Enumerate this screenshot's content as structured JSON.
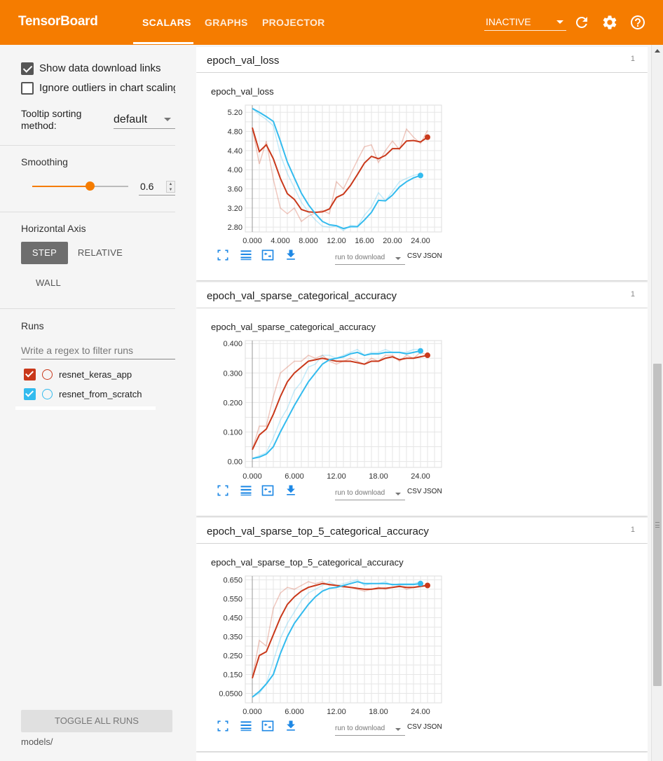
{
  "app": {
    "title": "TensorBoard"
  },
  "nav": {
    "tabs": [
      {
        "label": "SCALARS",
        "active": true
      },
      {
        "label": "GRAPHS",
        "active": false
      },
      {
        "label": "PROJECTOR",
        "active": false
      }
    ],
    "status_select": "INACTIVE",
    "icons": [
      "refresh-icon",
      "settings-gear-icon",
      "help-icon"
    ]
  },
  "sidebar": {
    "show_download_links": {
      "label": "Show data download links",
      "checked": true
    },
    "ignore_outliers": {
      "label": "Ignore outliers in chart scaling",
      "checked": false
    },
    "tooltip_sorting": {
      "label": "Tooltip sorting method:",
      "value": "default"
    },
    "smoothing": {
      "title": "Smoothing",
      "value": "0.6",
      "fraction": 0.6
    },
    "horizontal_axis": {
      "title": "Horizontal Axis",
      "options": [
        "STEP",
        "RELATIVE",
        "WALL"
      ],
      "selected": "STEP"
    },
    "runs": {
      "title": "Runs",
      "filter_placeholder": "Write a regex to filter runs",
      "items": [
        {
          "name": "resnet_keras_app",
          "color": "#c9381a",
          "checked": true
        },
        {
          "name": "resnet_from_scratch",
          "color": "#33bbee",
          "checked": true
        }
      ]
    },
    "toggle_all_label": "TOGGLE ALL RUNS",
    "logdir": "models/"
  },
  "cards": [
    {
      "group": "epoch_val_loss",
      "count": "1",
      "title": "epoch_val_loss",
      "download_placeholder": "run to download",
      "csv": "CSV",
      "json": "JSON"
    },
    {
      "group": "epoch_val_sparse_categorical_accuracy",
      "count": "1",
      "title": "epoch_val_sparse_categorical_accuracy",
      "download_placeholder": "run to download",
      "csv": "CSV",
      "json": "JSON"
    },
    {
      "group": "epoch_val_sparse_top_5_categorical_accuracy",
      "count": "1",
      "title": "epoch_val_sparse_top_5_categorical_accuracy",
      "download_placeholder": "run to download",
      "csv": "CSV",
      "json": "JSON"
    }
  ],
  "chart_data": [
    {
      "type": "line",
      "title": "epoch_val_loss",
      "xlabel": "",
      "ylabel": "",
      "xlim": [
        -1,
        27
      ],
      "ylim": [
        2.7,
        5.35
      ],
      "xticks": [
        0,
        4,
        8,
        12,
        16,
        20,
        24
      ],
      "xtick_labels": [
        "0.000",
        "4.000",
        "8.000",
        "12.00",
        "16.00",
        "20.00",
        "24.00"
      ],
      "yticks": [
        2.8,
        3.2,
        3.6,
        4.0,
        4.4,
        4.8,
        5.2
      ],
      "ytick_labels": [
        "2.80",
        "3.20",
        "3.60",
        "4.00",
        "4.40",
        "4.80",
        "5.20"
      ],
      "grid": true,
      "series": [
        {
          "name": "resnet_keras_app",
          "color": "#c9381a",
          "x": [
            0,
            1,
            2,
            3,
            4,
            5,
            6,
            7,
            8,
            9,
            10,
            11,
            12,
            13,
            14,
            15,
            16,
            17,
            18,
            19,
            20,
            21,
            22,
            23,
            24,
            25
          ],
          "raw": [
            4.88,
            4.12,
            4.6,
            3.8,
            3.2,
            3.08,
            3.2,
            2.92,
            3.03,
            3.1,
            3.15,
            3.08,
            3.75,
            3.6,
            3.9,
            4.2,
            4.48,
            4.52,
            4.15,
            4.4,
            4.6,
            4.42,
            4.85,
            4.68,
            4.55,
            4.82
          ],
          "smoothed": [
            4.88,
            4.38,
            4.52,
            4.23,
            3.82,
            3.5,
            3.38,
            3.17,
            3.12,
            3.11,
            3.12,
            3.18,
            3.42,
            3.49,
            3.67,
            3.9,
            4.14,
            4.28,
            4.23,
            4.3,
            4.44,
            4.44,
            4.6,
            4.61,
            4.58,
            4.68
          ]
        },
        {
          "name": "resnet_from_scratch",
          "color": "#33bbee",
          "x": [
            0,
            1,
            2,
            3,
            4,
            5,
            6,
            7,
            8,
            9,
            10,
            11,
            12,
            13,
            14,
            15,
            16,
            17,
            18,
            19,
            20,
            21,
            22,
            23,
            24
          ],
          "raw": [
            5.28,
            5.15,
            5.05,
            4.92,
            4.32,
            3.92,
            3.62,
            3.32,
            3.12,
            2.95,
            2.82,
            2.8,
            2.82,
            2.73,
            2.84,
            2.82,
            3.05,
            3.22,
            3.52,
            3.35,
            3.55,
            3.75,
            3.82,
            3.88,
            3.92
          ],
          "smoothed": [
            5.28,
            5.2,
            5.11,
            5.01,
            4.6,
            4.16,
            3.83,
            3.51,
            3.27,
            3.08,
            2.92,
            2.85,
            2.83,
            2.77,
            2.81,
            2.81,
            2.95,
            3.11,
            3.36,
            3.35,
            3.47,
            3.64,
            3.75,
            3.83,
            3.88
          ]
        }
      ]
    },
    {
      "type": "line",
      "title": "epoch_val_sparse_categorical_accuracy",
      "xlabel": "",
      "ylabel": "",
      "xlim": [
        -1,
        27
      ],
      "ylim": [
        -0.02,
        0.41
      ],
      "xticks": [
        0,
        6,
        12,
        18,
        24
      ],
      "xtick_labels": [
        "0.000",
        "6.000",
        "12.00",
        "18.00",
        "24.00"
      ],
      "yticks": [
        0,
        0.1,
        0.2,
        0.3,
        0.4
      ],
      "ytick_labels": [
        "0.00",
        "0.100",
        "0.200",
        "0.300",
        "0.400"
      ],
      "grid": true,
      "series": [
        {
          "name": "resnet_keras_app",
          "color": "#c9381a",
          "x": [
            0,
            1,
            2,
            3,
            4,
            5,
            6,
            7,
            8,
            9,
            10,
            11,
            12,
            13,
            14,
            15,
            16,
            17,
            18,
            19,
            20,
            21,
            22,
            23,
            24,
            25
          ],
          "raw": [
            0.04,
            0.12,
            0.12,
            0.22,
            0.3,
            0.32,
            0.34,
            0.34,
            0.36,
            0.35,
            0.36,
            0.34,
            0.33,
            0.34,
            0.35,
            0.34,
            0.33,
            0.35,
            0.34,
            0.36,
            0.36,
            0.34,
            0.36,
            0.35,
            0.37,
            0.36
          ],
          "smoothed": [
            0.04,
            0.09,
            0.11,
            0.16,
            0.22,
            0.27,
            0.3,
            0.32,
            0.34,
            0.345,
            0.35,
            0.345,
            0.34,
            0.34,
            0.34,
            0.335,
            0.33,
            0.34,
            0.34,
            0.35,
            0.355,
            0.345,
            0.35,
            0.35,
            0.355,
            0.36
          ]
        },
        {
          "name": "resnet_from_scratch",
          "color": "#33bbee",
          "x": [
            0,
            1,
            2,
            3,
            4,
            5,
            6,
            7,
            8,
            9,
            10,
            11,
            12,
            13,
            14,
            15,
            16,
            17,
            18,
            19,
            20,
            21,
            22,
            23,
            24
          ],
          "raw": [
            0.01,
            0.02,
            0.03,
            0.08,
            0.14,
            0.18,
            0.24,
            0.27,
            0.32,
            0.33,
            0.36,
            0.36,
            0.35,
            0.36,
            0.37,
            0.38,
            0.36,
            0.37,
            0.37,
            0.38,
            0.37,
            0.37,
            0.37,
            0.38,
            0.38
          ],
          "smoothed": [
            0.01,
            0.015,
            0.025,
            0.05,
            0.1,
            0.145,
            0.19,
            0.23,
            0.27,
            0.3,
            0.33,
            0.345,
            0.35,
            0.355,
            0.365,
            0.37,
            0.36,
            0.365,
            0.365,
            0.37,
            0.37,
            0.37,
            0.365,
            0.37,
            0.375
          ]
        }
      ]
    },
    {
      "type": "line",
      "title": "epoch_val_sparse_top_5_categorical_accuracy",
      "xlabel": "",
      "ylabel": "",
      "xlim": [
        -1,
        27
      ],
      "ylim": [
        0.0,
        0.67
      ],
      "xticks": [
        0,
        6,
        12,
        18,
        24
      ],
      "xtick_labels": [
        "0.000",
        "6.000",
        "12.00",
        "18.00",
        "24.00"
      ],
      "yticks": [
        0.05,
        0.15,
        0.25,
        0.35,
        0.45,
        0.55,
        0.65
      ],
      "ytick_labels": [
        "0.0500",
        "0.150",
        "0.250",
        "0.350",
        "0.450",
        "0.550",
        "0.650"
      ],
      "grid": true,
      "series": [
        {
          "name": "resnet_keras_app",
          "color": "#c9381a",
          "x": [
            0,
            1,
            2,
            3,
            4,
            5,
            6,
            7,
            8,
            9,
            10,
            11,
            12,
            13,
            14,
            15,
            16,
            17,
            18,
            19,
            20,
            21,
            22,
            23,
            24,
            25
          ],
          "raw": [
            0.13,
            0.33,
            0.3,
            0.5,
            0.58,
            0.61,
            0.6,
            0.62,
            0.64,
            0.63,
            0.64,
            0.62,
            0.62,
            0.61,
            0.61,
            0.6,
            0.59,
            0.6,
            0.61,
            0.6,
            0.61,
            0.62,
            0.6,
            0.61,
            0.62,
            0.62
          ],
          "smoothed": [
            0.13,
            0.25,
            0.27,
            0.36,
            0.45,
            0.52,
            0.56,
            0.59,
            0.61,
            0.62,
            0.63,
            0.625,
            0.62,
            0.615,
            0.61,
            0.605,
            0.6,
            0.6,
            0.605,
            0.605,
            0.61,
            0.615,
            0.61,
            0.61,
            0.615,
            0.62
          ]
        },
        {
          "name": "resnet_from_scratch",
          "color": "#33bbee",
          "x": [
            0,
            1,
            2,
            3,
            4,
            5,
            6,
            7,
            8,
            9,
            10,
            11,
            12,
            13,
            14,
            15,
            16,
            17,
            18,
            19,
            20,
            21,
            22,
            23,
            24
          ],
          "raw": [
            0.03,
            0.05,
            0.1,
            0.22,
            0.34,
            0.42,
            0.48,
            0.54,
            0.58,
            0.6,
            0.62,
            0.64,
            0.62,
            0.63,
            0.64,
            0.65,
            0.62,
            0.63,
            0.63,
            0.64,
            0.62,
            0.63,
            0.63,
            0.63,
            0.64
          ],
          "smoothed": [
            0.03,
            0.06,
            0.1,
            0.15,
            0.26,
            0.35,
            0.42,
            0.47,
            0.52,
            0.56,
            0.59,
            0.605,
            0.61,
            0.62,
            0.63,
            0.64,
            0.63,
            0.63,
            0.63,
            0.63,
            0.625,
            0.625,
            0.625,
            0.625,
            0.63
          ]
        }
      ]
    }
  ]
}
